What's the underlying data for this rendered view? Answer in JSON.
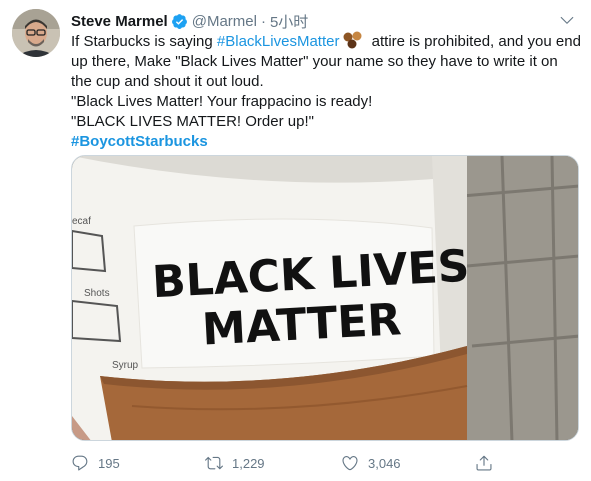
{
  "tweet": {
    "author_name": "Steve Marmel",
    "handle": "@Marmel",
    "separator": "·",
    "time": "5小时",
    "text": {
      "line1_pre": "If Starbucks is saying ",
      "hashtag1": "#BlackLivesMatter",
      "line1_post": " attire is prohibited, and you end up there, Make \"Black Lives Matter\" your name so they have to write it on the cup and shout it out loud.",
      "line2": "\"Black Lives Matter! Your frappacino is ready!",
      "line3": "\"BLACK LIVES MATTER!  Order up!\"",
      "hashtag2": "#BoycottStarbucks"
    },
    "image": {
      "cup_text_line1": "BLACK LIVES",
      "cup_text_line2": "MATTER"
    },
    "actions": {
      "replies": "195",
      "retweets": "1,229",
      "likes": "3,046"
    },
    "icons": {
      "verified": "verified-badge-icon",
      "caret": "chevron-down-icon",
      "reply": "reply-icon",
      "retweet": "retweet-icon",
      "like": "heart-icon",
      "share": "share-icon"
    },
    "colors": {
      "link": "#1b95e0",
      "secondary": "#657786",
      "text": "#14171a"
    }
  }
}
